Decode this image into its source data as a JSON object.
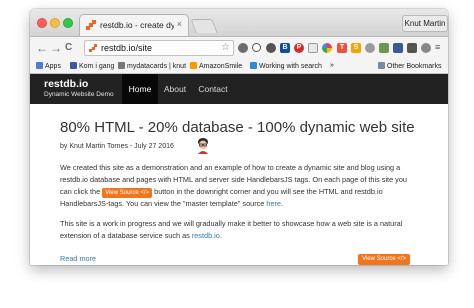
{
  "browser": {
    "tab_title": "restdb.io - create dynamic...",
    "tab_close": "×",
    "profile_name": "Knut Martin",
    "url": "restdb.io/site",
    "nav": {
      "back": "←",
      "forward": "→",
      "reload": "C",
      "home": "⌂"
    },
    "bookmarks": [
      {
        "label": "Apps",
        "icon": "apps-grid-icon",
        "color": "#4a7fd6"
      },
      {
        "label": "Kom i gang",
        "icon": "bookmark-favicon-icon",
        "color": "#3c5a99"
      },
      {
        "label": "mydatacards | knut",
        "icon": "bookmark-favicon-icon",
        "color": "#777777"
      },
      {
        "label": "AmazonSmile",
        "icon": "bookmark-favicon-icon",
        "color": "#ff9900"
      },
      {
        "label": "Working with search",
        "icon": "bookmark-favicon-icon",
        "color": "#2a8bd8"
      }
    ],
    "more_bookmarks": "»",
    "other_bookmarks": "Other Bookmarks"
  },
  "site": {
    "brand_title": "restdb.io",
    "brand_subtitle": "Dynamic Website Demo",
    "nav": {
      "home": "Home",
      "about": "About",
      "contact": "Contact"
    }
  },
  "post": {
    "title": "80% HTML - 20% database - 100% dynamic web site",
    "meta": "by Knut Martin Tornes - July 27 2016",
    "p1_part1": "We created this site as a demonstration and an example of how to create a dynamic site and blog using a restdb.io database and pages with HTML and server side HandlebarsJS tags. On each page of this site you can click the",
    "view_source_label": "View Source </>",
    "p1_part2": "button in the downright corner and  you will see the HTML and restdb.io HandlebarsJS-tags. You can view the \"master template\" source",
    "p1_link": "here",
    "p1_end": ".",
    "p2_part1": "This site is a work in progress and we will gradually make it better to showcase how a web site is a natural extension of a database service such as",
    "p2_link": "restdb.io",
    "p2_end": ".",
    "read_more": "Read more",
    "view_source_button": "View Source </>"
  },
  "colors": {
    "accent": "#f0761e",
    "navbar": "#222222",
    "link": "#337ab7"
  }
}
